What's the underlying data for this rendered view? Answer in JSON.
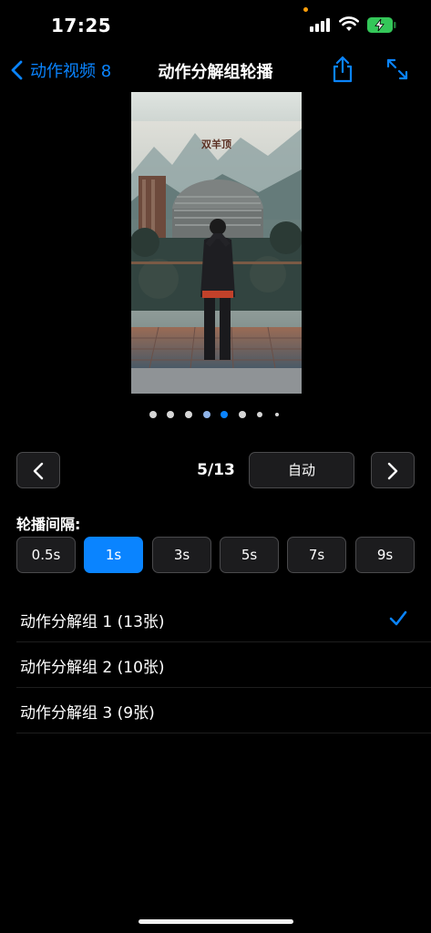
{
  "status_bar": {
    "time": "17:25"
  },
  "nav": {
    "back_label": "动作视频 8",
    "title": "动作分解组轮播"
  },
  "photo": {
    "caption": "双羊顶"
  },
  "carousel": {
    "current": "5/13",
    "auto_label": "自动"
  },
  "interval": {
    "label": "轮播间隔:",
    "options": [
      "0.5s",
      "1s",
      "3s",
      "5s",
      "7s",
      "9s"
    ],
    "selected": "1s"
  },
  "groups": [
    {
      "label": "动作分解组 1 (13张)",
      "checked": true
    },
    {
      "label": "动作分解组 2 (10张)",
      "checked": false
    },
    {
      "label": "动作分解组 3 (9张)",
      "checked": false
    }
  ],
  "colors": {
    "accent": "#0a84ff",
    "background": "#000000",
    "button": "#1c1c1e"
  }
}
